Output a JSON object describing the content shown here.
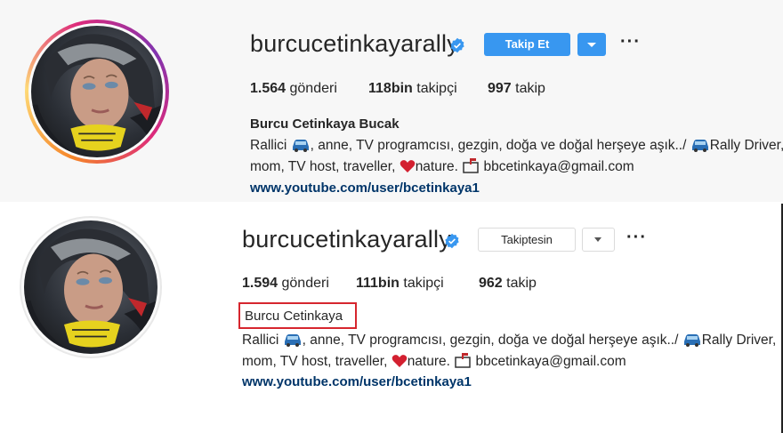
{
  "top": {
    "username": "burcucetinkayarally",
    "follow_label": "Takip Et",
    "more_label": "···",
    "stats": [
      {
        "count": "1.564",
        "label": "gönderi"
      },
      {
        "count": "118bin",
        "label": "takipçi"
      },
      {
        "count": "997",
        "label": "takip"
      }
    ],
    "full_name": "Burcu Cetinkaya Bucak",
    "bio_line1_a": "Rallici ",
    "bio_line1_b": ", anne, TV programcısı, gezgin, doğa ve doğal herşeye aşık../ ",
    "bio_line1_c": "Rally Driver,",
    "bio_line2_a": "mom, TV host, traveller, ",
    "bio_line2_b": "nature. ",
    "bio_line2_c": " bbcetinkaya@gmail.com",
    "link": "www.youtube.com/user/bcetinkaya1"
  },
  "bottom": {
    "username": "burcucetinkayarally",
    "following_label": "Takiptesin",
    "more_label": "···",
    "stats": [
      {
        "count": "1.594",
        "label": "gönderi"
      },
      {
        "count": "111bin",
        "label": "takipçi"
      },
      {
        "count": "962",
        "label": "takip"
      }
    ],
    "full_name": "Burcu Cetinkaya",
    "bio_line1_a": "Rallici ",
    "bio_line1_b": ", anne, TV programcısı, gezgin, doğa ve doğal herşeye aşık../ ",
    "bio_line1_c": "Rally Driver,",
    "bio_line2_a": "mom, TV host, traveller, ",
    "bio_line2_b": "nature. ",
    "bio_line2_c": " bbcetinkaya@gmail.com",
    "link": "www.youtube.com/user/bcetinkaya1"
  },
  "colors": {
    "follow_button": "#3897f0",
    "verified_badge": "#3897f0",
    "link": "#003569",
    "highlight_box": "#d6262e"
  },
  "icons": [
    "verified-badge-icon",
    "car-emoji-icon",
    "heart-emoji-icon",
    "mailbox-emoji-icon",
    "chevron-down-icon",
    "more-options-icon"
  ]
}
